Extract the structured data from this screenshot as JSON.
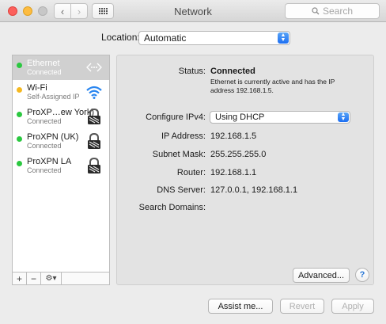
{
  "window": {
    "title": "Network",
    "search_placeholder": "Search"
  },
  "location": {
    "label": "Location:",
    "value": "Automatic"
  },
  "services": [
    {
      "name": "Ethernet",
      "status": "Connected",
      "dot_color": "#2bc840",
      "icon": "ethernet-icon",
      "selected": true
    },
    {
      "name": "Wi-Fi",
      "status": "Self-Assigned IP",
      "dot_color": "#f5b820",
      "icon": "wifi-icon"
    },
    {
      "name": "ProXP…ew York)",
      "status": "Connected",
      "dot_color": "#2bc840",
      "icon": "lock-icon"
    },
    {
      "name": "ProXPN (UK)",
      "status": "Connected",
      "dot_color": "#2bc840",
      "icon": "lock-icon"
    },
    {
      "name": "ProXPN LA",
      "status": "Connected",
      "dot_color": "#2bc840",
      "icon": "lock-icon"
    }
  ],
  "sidebar_toolbar": {
    "add": "+",
    "remove": "−",
    "action": "⚙▾"
  },
  "detail": {
    "status_label": "Status:",
    "status_value": "Connected",
    "status_desc": "Ethernet is currently active and has the IP address 192.168.1.5.",
    "configure_label": "Configure IPv4:",
    "configure_value": "Using DHCP",
    "ip_label": "IP Address:",
    "ip_value": "192.168.1.5",
    "subnet_label": "Subnet Mask:",
    "subnet_value": "255.255.255.0",
    "router_label": "Router:",
    "router_value": "192.168.1.1",
    "dns_label": "DNS Server:",
    "dns_value": "127.0.0.1, 192.168.1.1",
    "search_domains_label": "Search Domains:",
    "advanced_button": "Advanced...",
    "help_button": "?"
  },
  "footer": {
    "assist": "Assist me...",
    "revert": "Revert",
    "apply": "Apply"
  },
  "colors": {
    "accent": "#1c6ef2",
    "connected": "#2bc840",
    "warning": "#f5b820"
  }
}
